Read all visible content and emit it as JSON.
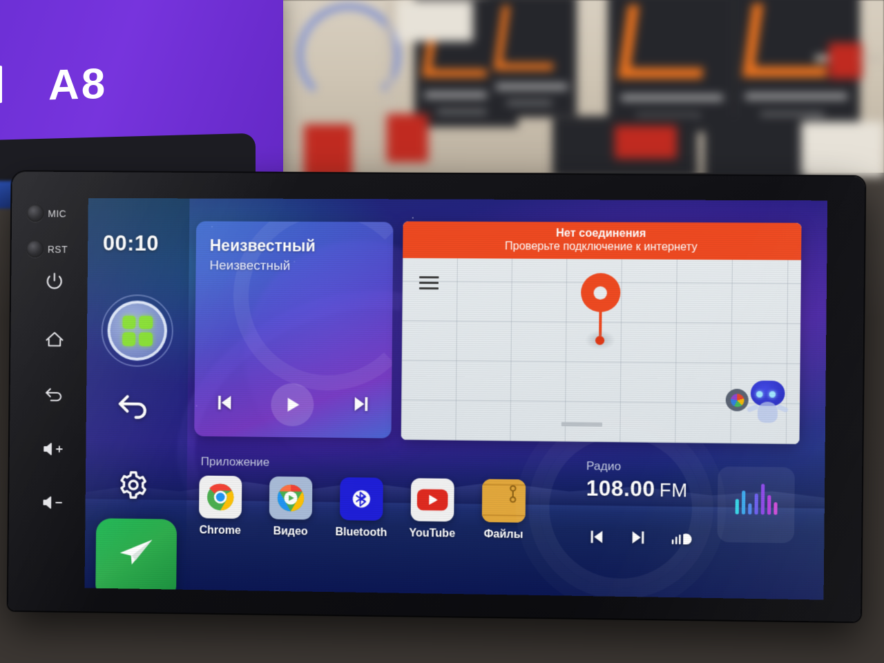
{
  "background": {
    "product_box_brand_mark": "®",
    "product_box_model": "A8"
  },
  "device": {
    "hardware": {
      "mic_label": "MIC",
      "reset_label": "RST",
      "buttons": [
        {
          "name": "power-button",
          "label": "power"
        },
        {
          "name": "home-button",
          "label": "home"
        },
        {
          "name": "back-button",
          "label": "back"
        },
        {
          "name": "volume-up-button",
          "label": "volume up"
        },
        {
          "name": "volume-down-button",
          "label": "volume down"
        }
      ]
    }
  },
  "screen": {
    "rail": {
      "clock": "00:10",
      "app_drawer_label": "apps",
      "back_label": "back",
      "settings_label": "settings",
      "navigation_label": "navigation"
    },
    "music_widget": {
      "title": "Неизвестный",
      "artist": "Неизвестный",
      "prev_label": "prev",
      "play_label": "play",
      "next_label": "next"
    },
    "map_widget": {
      "banner_title": "Нет соединения",
      "banner_subtitle": "Проверьте подключение к интернету",
      "menu_label": "menu",
      "pin_label": "location pin",
      "assistant_label": "assistant"
    },
    "apps": {
      "section_label": "Приложение",
      "items": [
        {
          "name": "chrome",
          "label": "Chrome"
        },
        {
          "name": "video",
          "label": "Видео"
        },
        {
          "name": "bluetooth",
          "label": "Bluetooth"
        },
        {
          "name": "youtube",
          "label": "YouTube"
        },
        {
          "name": "files",
          "label": "Файлы"
        }
      ]
    },
    "radio_widget": {
      "label": "Радио",
      "frequency": "108.00",
      "band": "FM",
      "prev_label": "previous station",
      "next_label": "next station",
      "eq_label": "equalizer"
    }
  },
  "colors": {
    "accent_orange": "#ef4a21",
    "accent_green": "#84e02c",
    "bluetooth_blue": "#1f1fd8",
    "youtube_red": "#e02a20",
    "nav_tile_green": "#1db954"
  }
}
